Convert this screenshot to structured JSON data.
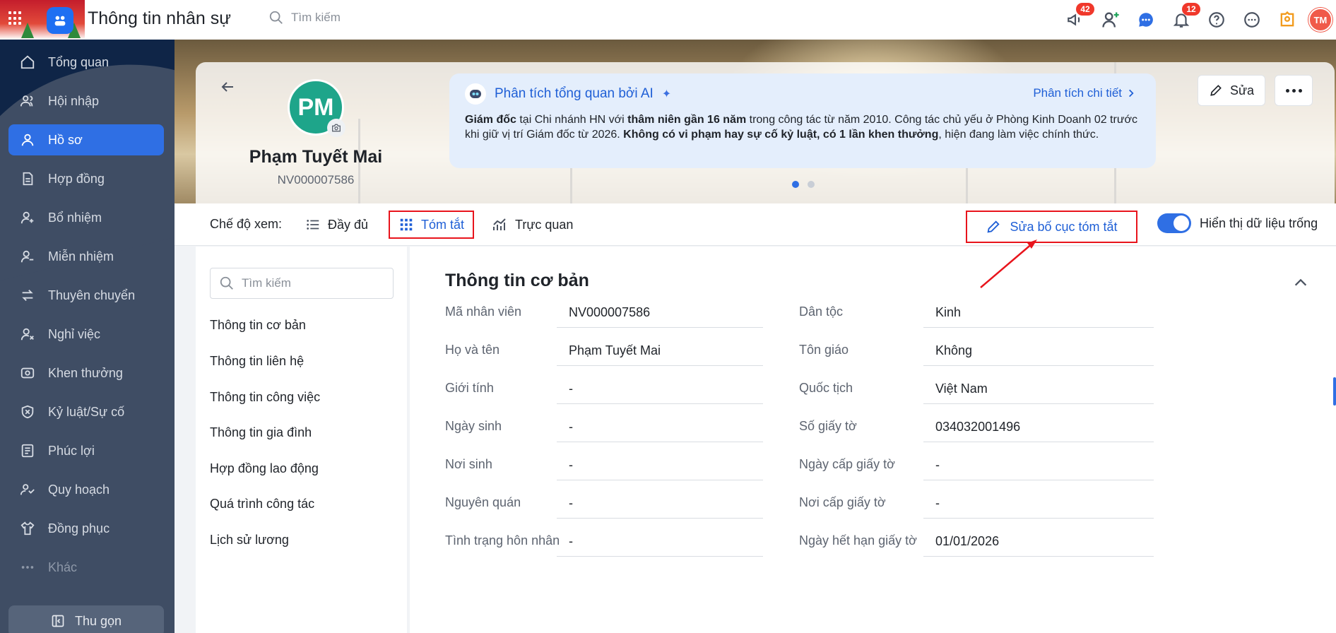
{
  "app": {
    "title": "Thông tin nhân sự",
    "search_placeholder": "Tìm kiếm",
    "badges": {
      "announcements": "42",
      "notifications": "12"
    },
    "user_initials": "TM"
  },
  "sidebar": {
    "items": [
      {
        "label": "Tổng quan",
        "icon": "home-icon"
      },
      {
        "label": "Hội nhập",
        "icon": "users-icon"
      },
      {
        "label": "Hồ sơ",
        "icon": "user-icon",
        "active": true
      },
      {
        "label": "Hợp đồng",
        "icon": "document-icon"
      },
      {
        "label": "Bổ nhiệm",
        "icon": "user-plus-icon"
      },
      {
        "label": "Miễn nhiệm",
        "icon": "user-minus-icon"
      },
      {
        "label": "Thuyên chuyển",
        "icon": "transfer-icon"
      },
      {
        "label": "Nghỉ việc",
        "icon": "user-x-icon"
      },
      {
        "label": "Khen thưởng",
        "icon": "award-icon"
      },
      {
        "label": "Kỷ luật/Sự cố",
        "icon": "shield-icon"
      },
      {
        "label": "Phúc lợi",
        "icon": "benefit-icon"
      },
      {
        "label": "Quy hoạch",
        "icon": "planning-icon"
      },
      {
        "label": "Đồng phục",
        "icon": "shirt-icon"
      },
      {
        "label": "Khác",
        "icon": "more-icon",
        "muted": true
      }
    ],
    "collapse_label": "Thu gọn"
  },
  "profile": {
    "initials": "PM",
    "name": "Phạm Tuyết Mai",
    "code": "NV000007586",
    "edit_label": "Sửa"
  },
  "ai_summary": {
    "title": "Phân tích tổng quan bởi AI",
    "detail_link": "Phân tích chi tiết",
    "parts": [
      {
        "t": "Giám đốc",
        "b": true
      },
      {
        "t": " tại Chi nhánh HN với ",
        "b": false
      },
      {
        "t": "thâm niên gần 16 năm",
        "b": true
      },
      {
        "t": " trong công tác từ năm 2010. Công tác chủ yếu ở Phòng Kinh Doanh 02 trước khi giữ vị trí Giám đốc từ 2026. ",
        "b": false
      },
      {
        "t": "Không có vi phạm hay sự cố kỷ luật, có 1 lần khen thưởng",
        "b": true
      },
      {
        "t": ", hiện đang làm việc chính thức.",
        "b": false
      }
    ]
  },
  "view_mode": {
    "label": "Chế độ xem:",
    "options": [
      "Đầy đủ",
      "Tóm tắt",
      "Trực quan"
    ],
    "active": "Tóm tắt",
    "edit_layout": "Sửa bố cục tóm tắt",
    "show_empty": "Hiển thị dữ liệu trống",
    "show_empty_on": true
  },
  "left_nav": {
    "search_placeholder": "Tìm kiếm",
    "items": [
      "Thông tin cơ bản",
      "Thông tin liên hệ",
      "Thông tin công việc",
      "Thông tin gia đình",
      "Hợp đồng lao động",
      "Quá trình công tác",
      "Lịch sử lương"
    ]
  },
  "section": {
    "title": "Thông tin cơ bản",
    "left_fields": [
      {
        "label": "Mã nhân viên",
        "value": "NV000007586"
      },
      {
        "label": "Họ và tên",
        "value": "Phạm Tuyết Mai"
      },
      {
        "label": "Giới tính",
        "value": "-"
      },
      {
        "label": "Ngày sinh",
        "value": "-"
      },
      {
        "label": "Nơi sinh",
        "value": "-"
      },
      {
        "label": "Nguyên quán",
        "value": "-"
      },
      {
        "label": "Tình trạng hôn nhân",
        "value": "-"
      }
    ],
    "right_fields": [
      {
        "label": "Dân tộc",
        "value": "Kinh"
      },
      {
        "label": "Tôn giáo",
        "value": "Không"
      },
      {
        "label": "Quốc tịch",
        "value": "Việt Nam"
      },
      {
        "label": "Số giấy tờ",
        "value": "034032001496"
      },
      {
        "label": "Ngày cấp giấy tờ",
        "value": "-"
      },
      {
        "label": "Nơi cấp giấy tờ",
        "value": "-"
      },
      {
        "label": "Ngày hết hạn giấy tờ",
        "value": "01/01/2026"
      }
    ]
  },
  "colors": {
    "accent": "#2f6fe4",
    "highlight": "#e8141c",
    "sidebar": "#3f4d64"
  }
}
